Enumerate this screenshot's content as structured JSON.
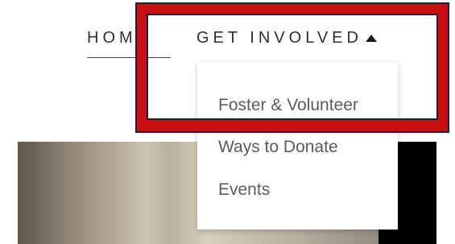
{
  "nav": {
    "home_label": "HOM",
    "get_involved_label": "GET INVOLVED",
    "caret_icon": "caret-up-icon"
  },
  "dropdown": {
    "items": [
      {
        "label": "Foster & Volunteer"
      },
      {
        "label": "Ways to Donate"
      },
      {
        "label": "Events"
      }
    ]
  },
  "colors": {
    "highlight": "#c81010",
    "text": "#2f2f2f",
    "menu_text": "#5b5b5b"
  }
}
